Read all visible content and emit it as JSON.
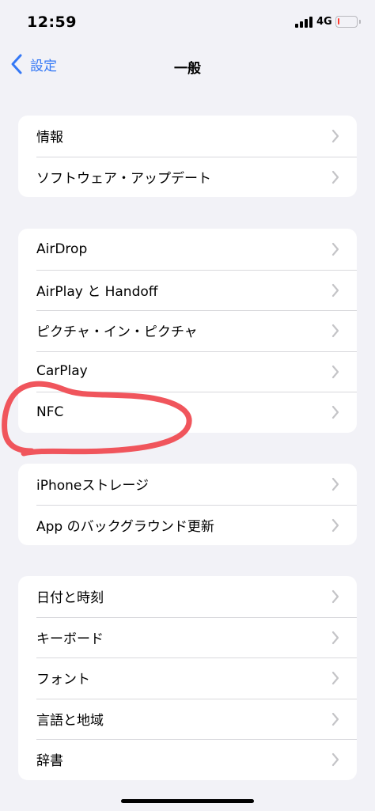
{
  "status_bar": {
    "time": "12:59",
    "network": "4G",
    "battery_level": 0.1,
    "battery_color": "#ff3b30"
  },
  "nav": {
    "back_label": "設定",
    "title": "一般",
    "accent_color": "#3478f6"
  },
  "groups": [
    {
      "items": [
        {
          "label": "情報"
        },
        {
          "label": "ソフトウェア・アップデート"
        }
      ]
    },
    {
      "items": [
        {
          "label": "AirDrop"
        },
        {
          "label": "AirPlay と Handoff"
        },
        {
          "label": "ピクチャ・イン・ピクチャ"
        },
        {
          "label": "CarPlay"
        },
        {
          "label": "NFC"
        }
      ]
    },
    {
      "items": [
        {
          "label": "iPhoneストレージ"
        },
        {
          "label": "App のバックグラウンド更新"
        }
      ]
    },
    {
      "items": [
        {
          "label": "日付と時刻"
        },
        {
          "label": "キーボード"
        },
        {
          "label": "フォント"
        },
        {
          "label": "言語と地域"
        },
        {
          "label": "辞書"
        }
      ]
    }
  ],
  "annotation": {
    "color": "#f0555c",
    "shape": "hand-drawn circle around NFC"
  },
  "icons": {
    "chevron": "chevron-right-icon",
    "back": "chevron-left-icon"
  }
}
